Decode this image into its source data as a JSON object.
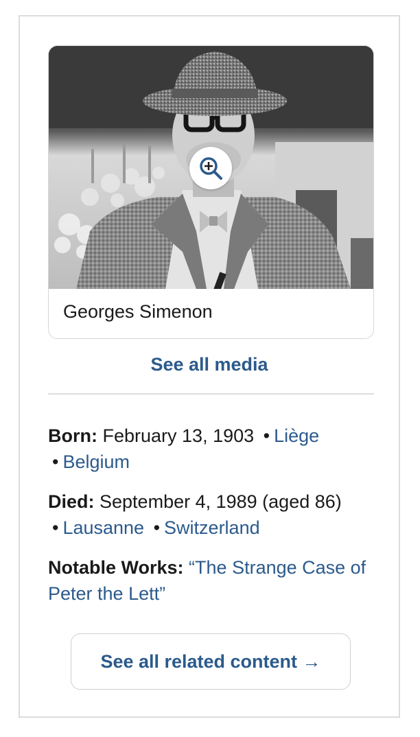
{
  "media": {
    "caption": "Georges Simenon",
    "zoom_icon": "zoom-in-icon",
    "see_all_media": "See all media"
  },
  "facts": {
    "born": {
      "label": "Born:",
      "date": "February 13, 1903",
      "place_city": "Liège",
      "place_country": "Belgium"
    },
    "died": {
      "label": "Died:",
      "date": "September 4, 1989 (aged 86)",
      "place_city": "Lausanne",
      "place_country": "Switzerland"
    },
    "notable_works": {
      "label": "Notable Works:",
      "work": "“The Strange Case of Peter the Lett”"
    },
    "separator": "•"
  },
  "related": {
    "label": "See all related content →"
  },
  "colors": {
    "link": "#2b5a8c",
    "border": "#dcdcdc"
  }
}
